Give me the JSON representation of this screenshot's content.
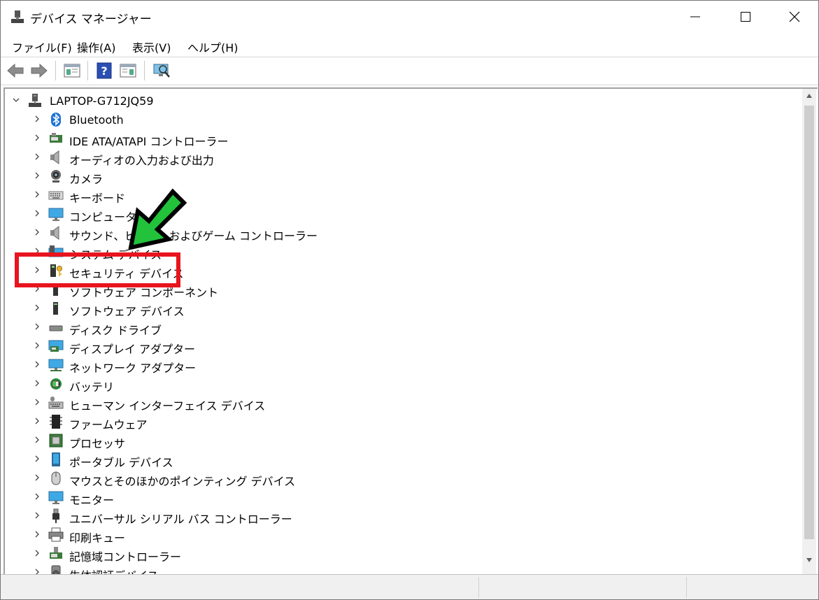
{
  "window": {
    "title": "デバイス マネージャー"
  },
  "menu": [
    {
      "label": "ファイル(F)"
    },
    {
      "label": "操作(A)"
    },
    {
      "label": "表示(V)"
    },
    {
      "label": "ヘルプ(H)"
    }
  ],
  "toolbar": [
    "back-icon",
    "forward-icon",
    "show-hide-console-tree-icon",
    "help-icon",
    "action-pane-icon",
    "scan-hardware-icon"
  ],
  "tree": {
    "root": {
      "label": "LAPTOP-G712JQ59",
      "icon": "computer-icon"
    },
    "items": [
      {
        "label": "Bluetooth",
        "icon": "bluetooth-icon"
      },
      {
        "label": "IDE ATA/ATAPI コントローラー",
        "icon": "ide-controller-icon"
      },
      {
        "label": "オーディオの入力および出力",
        "icon": "speaker-icon"
      },
      {
        "label": "カメラ",
        "icon": "camera-icon"
      },
      {
        "label": "キーボード",
        "icon": "keyboard-icon"
      },
      {
        "label": "コンピューター",
        "icon": "monitor-icon"
      },
      {
        "label": "サウンド、ビデオ、およびゲーム コントローラー",
        "icon": "speaker-icon"
      },
      {
        "label": "システム デバイス",
        "icon": "system-device-icon"
      },
      {
        "label": "セキュリティ デバイス",
        "icon": "security-key-icon"
      },
      {
        "label": "ソフトウェア コンポーネント",
        "icon": "software-component-icon"
      },
      {
        "label": "ソフトウェア デバイス",
        "icon": "software-device-icon"
      },
      {
        "label": "ディスク ドライブ",
        "icon": "disk-drive-icon"
      },
      {
        "label": "ディスプレイ アダプター",
        "icon": "display-adapter-icon"
      },
      {
        "label": "ネットワーク アダプター",
        "icon": "network-adapter-icon"
      },
      {
        "label": "バッテリ",
        "icon": "battery-icon"
      },
      {
        "label": "ヒューマン インターフェイス デバイス",
        "icon": "hid-icon"
      },
      {
        "label": "ファームウェア",
        "icon": "firmware-icon"
      },
      {
        "label": "プロセッサ",
        "icon": "processor-icon"
      },
      {
        "label": "ポータブル デバイス",
        "icon": "portable-device-icon"
      },
      {
        "label": "マウスとそのほかのポインティング デバイス",
        "icon": "mouse-icon"
      },
      {
        "label": "モニター",
        "icon": "monitor-icon"
      },
      {
        "label": "ユニバーサル シリアル バス コントローラー",
        "icon": "usb-icon"
      },
      {
        "label": "印刷キュー",
        "icon": "printer-icon"
      },
      {
        "label": "記憶域コントローラー",
        "icon": "storage-controller-icon"
      },
      {
        "label": "生体認証デバイス",
        "icon": "biometric-icon"
      }
    ]
  },
  "colors": {
    "highlight": "#e8141e",
    "arrow": "#22c23a"
  }
}
